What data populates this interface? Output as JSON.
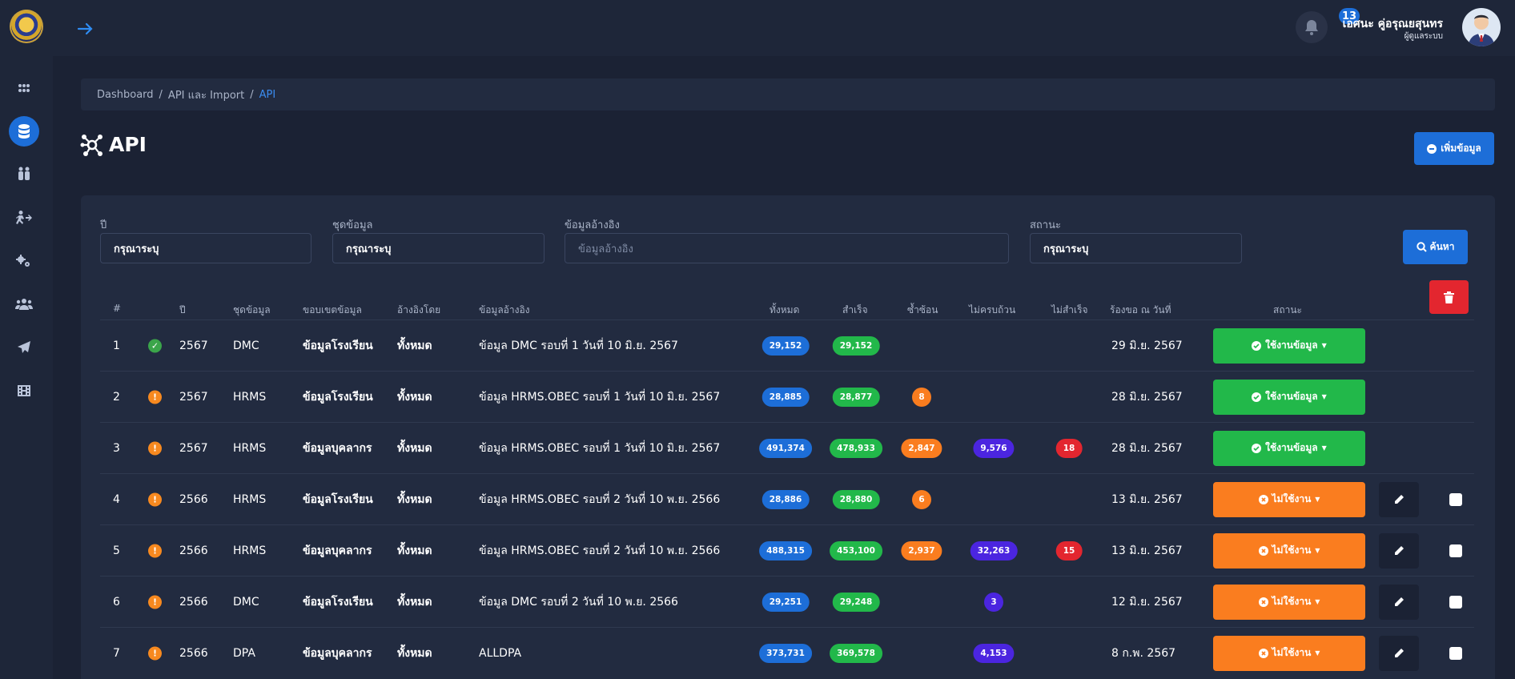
{
  "header": {
    "notification_count": "13",
    "user_name": "เอศนะ คู่อรุณยสุนทร",
    "user_role": "ผู้ดูแลระบบ"
  },
  "breadcrumb": [
    "Dashboard",
    "API และ Import",
    "API"
  ],
  "page": {
    "title": "API",
    "add_button": "เพิ่มข้อมูล"
  },
  "filters": {
    "year": {
      "label": "ปี",
      "value": "กรุณาระบุ"
    },
    "dataset": {
      "label": "ชุดข้อมูล",
      "value": "กรุณาระบุ"
    },
    "reference": {
      "label": "ข้อมูลอ้างอิง",
      "placeholder": "ข้อมูลอ้างอิง"
    },
    "status": {
      "label": "สถานะ",
      "value": "กรุณาระบุ"
    },
    "search_button": "ค้นหา"
  },
  "table": {
    "columns": [
      "#",
      "ปี",
      "ชุดข้อมูล",
      "ขอบเขตข้อมูล",
      "อ้างอิงโดย",
      "ข้อมูลอ้างอิง",
      "ทั้งหมด",
      "สำเร็จ",
      "ซ้ำซ้อน",
      "ไม่ครบถ้วน",
      "ไม่สำเร็จ",
      "ร้องขอ ณ วันที่",
      "สถานะ"
    ],
    "rows": [
      {
        "n": "1",
        "state": "ok",
        "year": "2567",
        "set": "DMC",
        "scope": "ข้อมูลโรงเรียน",
        "by": "ทั้งหมด",
        "ref": "ข้อมูล DMC รอบที่ 1 วันที่ 10 มิ.ย. 2567",
        "total": "29,152",
        "ok": "29,152",
        "dup": "",
        "inc": "",
        "fail": "",
        "date": "29 มิ.ย. 2567",
        "status": "ใช้งานข้อมูล",
        "active": true
      },
      {
        "n": "2",
        "state": "warn",
        "year": "2567",
        "set": "HRMS",
        "scope": "ข้อมูลโรงเรียน",
        "by": "ทั้งหมด",
        "ref": "ข้อมูล HRMS.OBEC รอบที่ 1 วันที่ 10 มิ.ย. 2567",
        "total": "28,885",
        "ok": "28,877",
        "dup": "8",
        "inc": "",
        "fail": "",
        "date": "28 มิ.ย. 2567",
        "status": "ใช้งานข้อมูล",
        "active": true
      },
      {
        "n": "3",
        "state": "warn",
        "year": "2567",
        "set": "HRMS",
        "scope": "ข้อมูลบุคลากร",
        "by": "ทั้งหมด",
        "ref": "ข้อมูล HRMS.OBEC รอบที่ 1 วันที่ 10 มิ.ย. 2567",
        "total": "491,374",
        "ok": "478,933",
        "dup": "2,847",
        "inc": "9,576",
        "fail": "18",
        "date": "28 มิ.ย. 2567",
        "status": "ใช้งานข้อมูล",
        "active": true
      },
      {
        "n": "4",
        "state": "warn",
        "year": "2566",
        "set": "HRMS",
        "scope": "ข้อมูลโรงเรียน",
        "by": "ทั้งหมด",
        "ref": "ข้อมูล HRMS.OBEC รอบที่ 2 วันที่ 10 พ.ย. 2566",
        "total": "28,886",
        "ok": "28,880",
        "dup": "6",
        "inc": "",
        "fail": "",
        "date": "13 มิ.ย. 2567",
        "status": "ไม่ใช้งาน",
        "active": false
      },
      {
        "n": "5",
        "state": "warn",
        "year": "2566",
        "set": "HRMS",
        "scope": "ข้อมูลบุคลากร",
        "by": "ทั้งหมด",
        "ref": "ข้อมูล HRMS.OBEC รอบที่ 2 วันที่ 10 พ.ย. 2566",
        "total": "488,315",
        "ok": "453,100",
        "dup": "2,937",
        "inc": "32,263",
        "fail": "15",
        "date": "13 มิ.ย. 2567",
        "status": "ไม่ใช้งาน",
        "active": false
      },
      {
        "n": "6",
        "state": "warn",
        "year": "2566",
        "set": "DMC",
        "scope": "ข้อมูลโรงเรียน",
        "by": "ทั้งหมด",
        "ref": "ข้อมูล DMC รอบที่ 2 วันที่ 10 พ.ย. 2566",
        "total": "29,251",
        "ok": "29,248",
        "dup": "",
        "inc": "3",
        "fail": "",
        "date": "12 มิ.ย. 2567",
        "status": "ไม่ใช้งาน",
        "active": false
      },
      {
        "n": "7",
        "state": "warn",
        "year": "2566",
        "set": "DPA",
        "scope": "ข้อมูลบุคลากร",
        "by": "ทั้งหมด",
        "ref": "ALLDPA",
        "total": "373,731",
        "ok": "369,578",
        "dup": "",
        "inc": "4,153",
        "fail": "",
        "date": "8 ก.พ. 2567",
        "status": "ไม่ใช้งาน",
        "active": false
      }
    ]
  },
  "colors": {
    "primary": "#1d6ed8",
    "success": "#22b84a",
    "warning": "#fa7d1f",
    "purple": "#4b25e0",
    "danger": "#e3262f"
  }
}
